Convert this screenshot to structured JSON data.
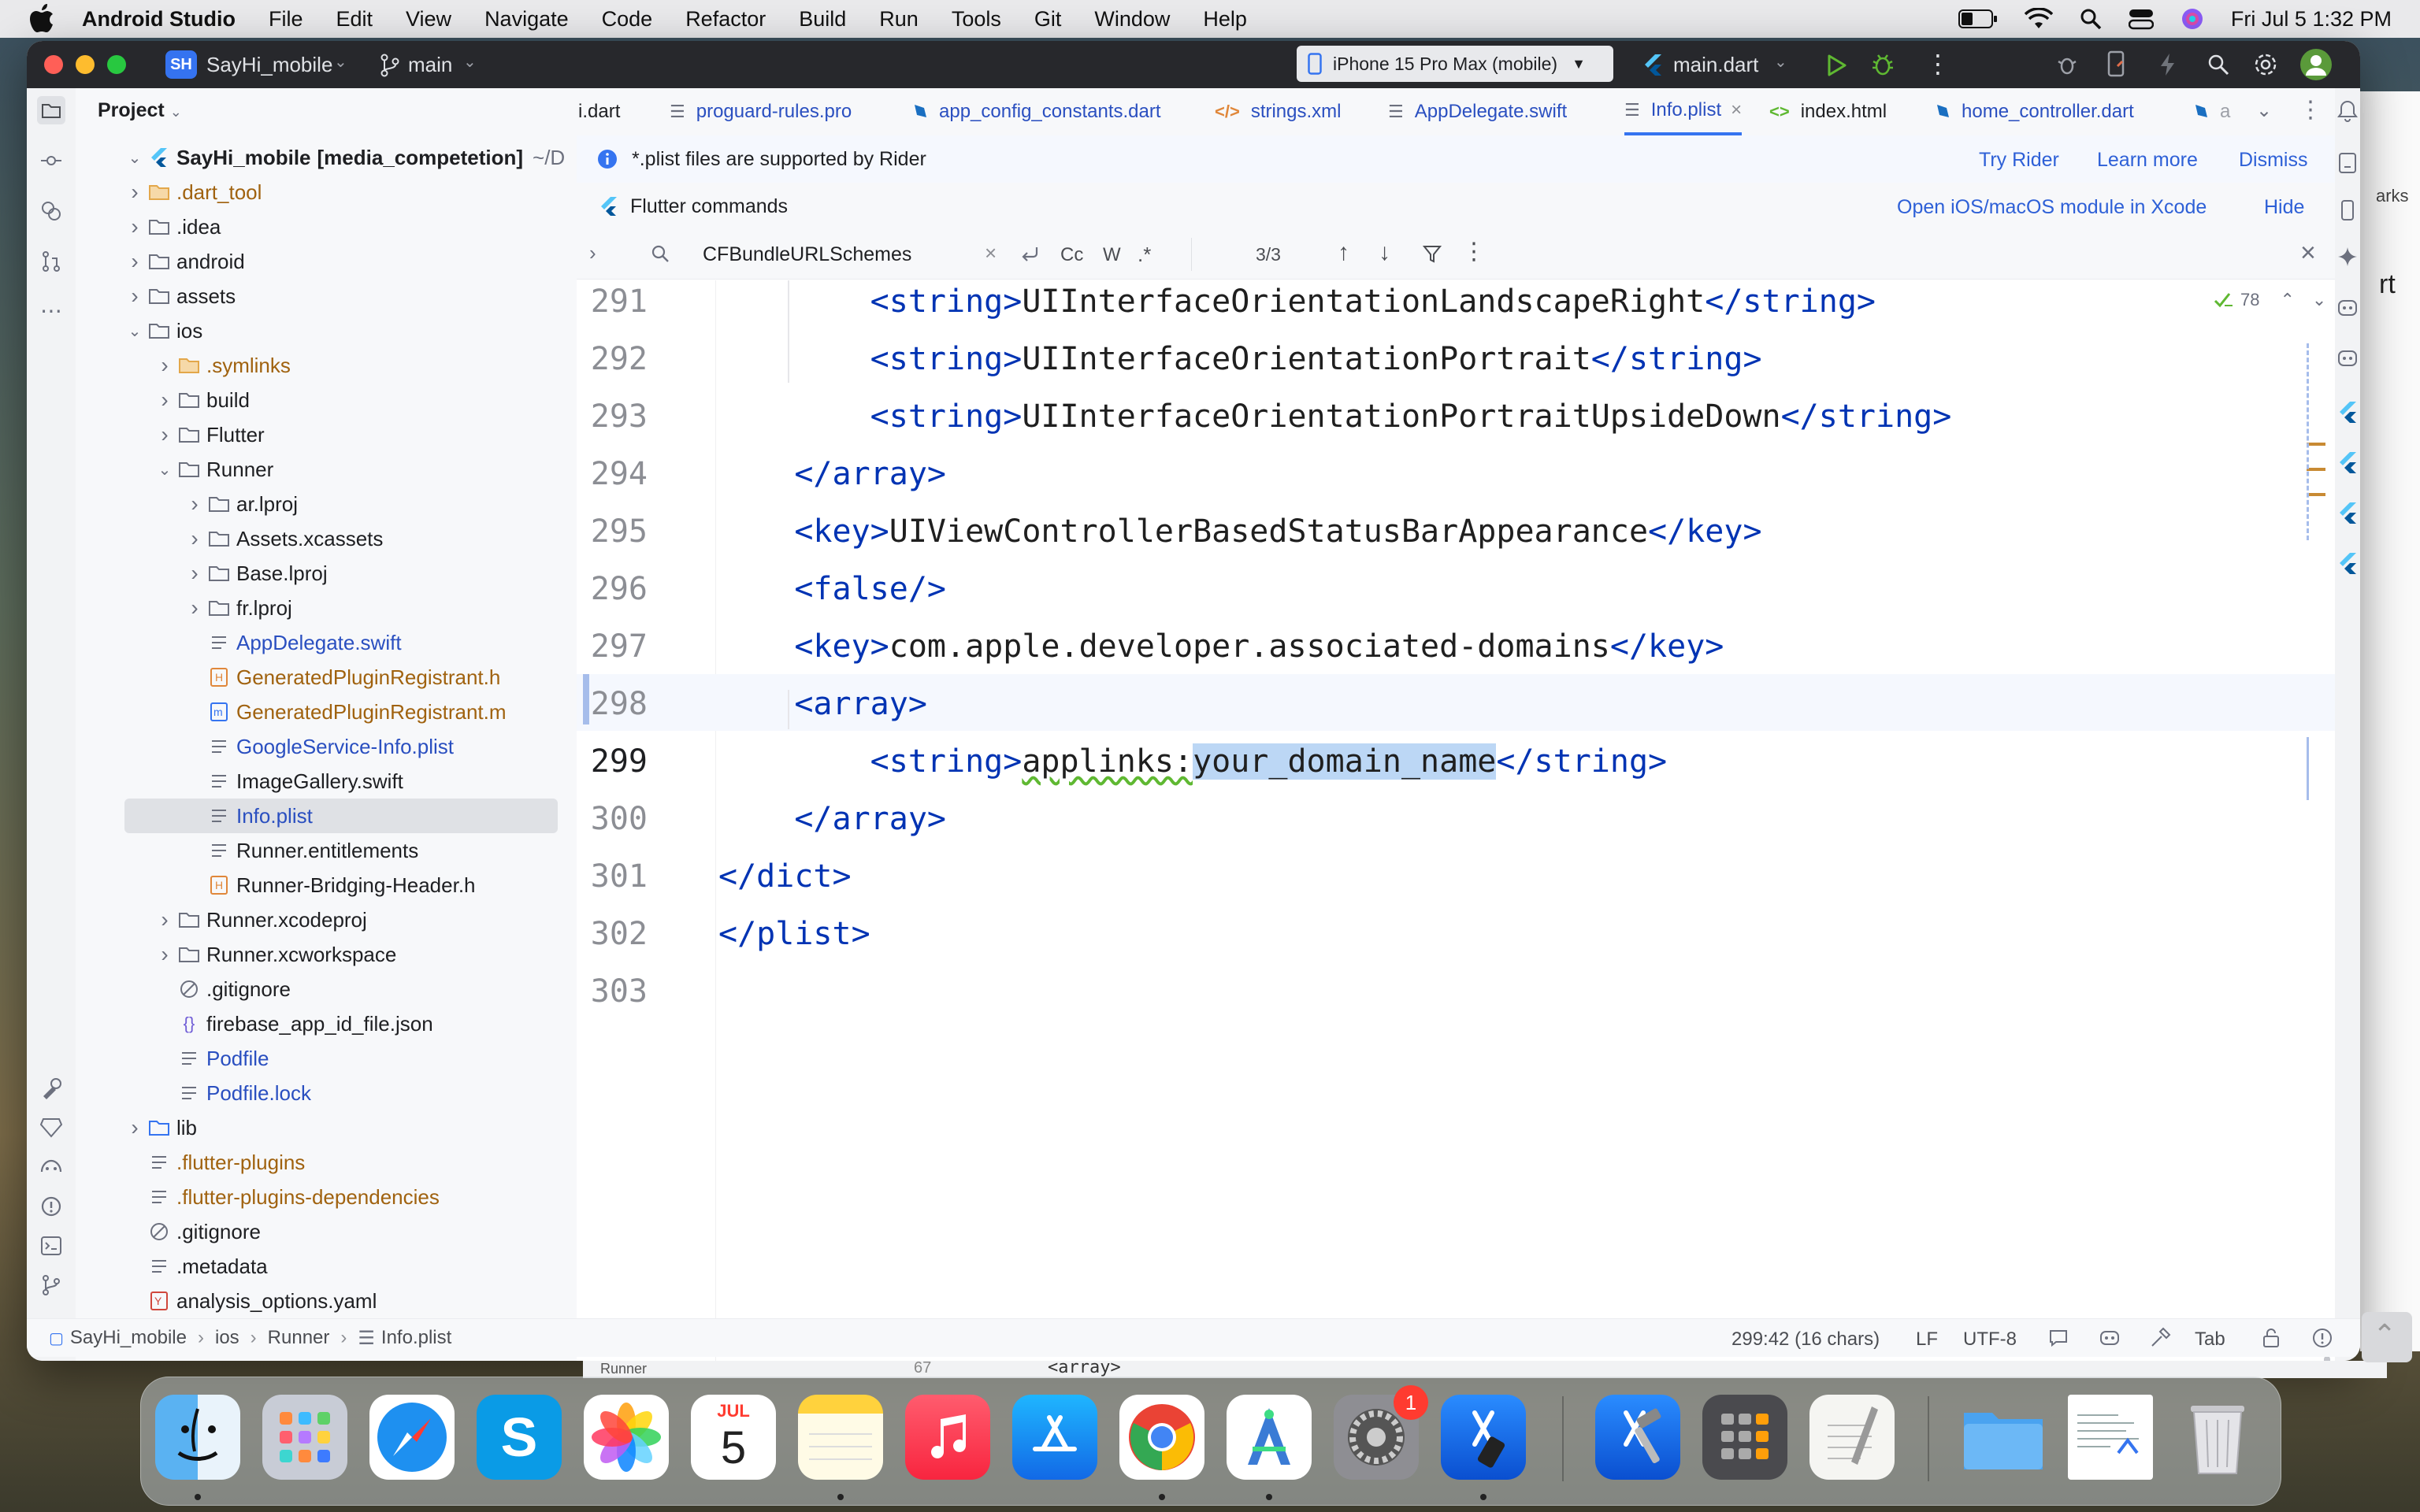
{
  "menubar": {
    "app_name": "Android Studio",
    "menus": [
      "File",
      "Edit",
      "View",
      "Navigate",
      "Code",
      "Refactor",
      "Build",
      "Run",
      "Tools",
      "Git",
      "Window",
      "Help"
    ],
    "datetime": "Fri Jul 5  1:32 PM"
  },
  "titlebar": {
    "project_badge": "SH",
    "project_name": "SayHi_mobile",
    "branch": "main",
    "device": "iPhone 15 Pro Max (mobile)",
    "run_config": "main.dart"
  },
  "project_panel": {
    "title": "Project",
    "root_name": "SayHi_mobile",
    "root_module": "[media_competetion]",
    "root_path": "~/D",
    "items": [
      {
        "label": ".dart_tool",
        "color": "#a0620f"
      },
      {
        "label": ".idea",
        "color": "#1e1f22"
      },
      {
        "label": "android",
        "color": "#1e1f22"
      },
      {
        "label": "assets",
        "color": "#1e1f22"
      },
      {
        "label": "ios",
        "color": "#1e1f22"
      },
      {
        "label": ".symlinks",
        "color": "#a0620f"
      },
      {
        "label": "build",
        "color": "#1e1f22"
      },
      {
        "label": "Flutter",
        "color": "#1e1f22"
      },
      {
        "label": "Runner",
        "color": "#1e1f22"
      },
      {
        "label": "ar.lproj",
        "color": "#1e1f22"
      },
      {
        "label": "Assets.xcassets",
        "color": "#1e1f22"
      },
      {
        "label": "Base.lproj",
        "color": "#1e1f22"
      },
      {
        "label": "fr.lproj",
        "color": "#1e1f22"
      },
      {
        "label": "AppDelegate.swift",
        "color": "#2a4fc0"
      },
      {
        "label": "GeneratedPluginRegistrant.h",
        "color": "#a0620f"
      },
      {
        "label": "GeneratedPluginRegistrant.m",
        "color": "#a0620f"
      },
      {
        "label": "GoogleService-Info.plist",
        "color": "#2a4fc0"
      },
      {
        "label": "ImageGallery.swift",
        "color": "#1e1f22"
      },
      {
        "label": "Info.plist",
        "color": "#2a4fc0"
      },
      {
        "label": "Runner.entitlements",
        "color": "#1e1f22"
      },
      {
        "label": "Runner-Bridging-Header.h",
        "color": "#1e1f22"
      },
      {
        "label": "Runner.xcodeproj",
        "color": "#1e1f22"
      },
      {
        "label": "Runner.xcworkspace",
        "color": "#1e1f22"
      },
      {
        "label": ".gitignore",
        "color": "#1e1f22"
      },
      {
        "label": "firebase_app_id_file.json",
        "color": "#1e1f22"
      },
      {
        "label": "Podfile",
        "color": "#2a4fc0"
      },
      {
        "label": "Podfile.lock",
        "color": "#2a4fc0"
      },
      {
        "label": "lib",
        "color": "#1e1f22"
      },
      {
        "label": ".flutter-plugins",
        "color": "#a0620f"
      },
      {
        "label": ".flutter-plugins-dependencies",
        "color": "#a0620f"
      },
      {
        "label": ".gitignore",
        "color": "#1e1f22"
      },
      {
        "label": ".metadata",
        "color": "#1e1f22"
      },
      {
        "label": "analysis_options.yaml",
        "color": "#1e1f22"
      }
    ]
  },
  "tabs": [
    {
      "label": "i.dart"
    },
    {
      "label": "proguard-rules.pro"
    },
    {
      "label": "app_config_constants.dart"
    },
    {
      "label": "strings.xml"
    },
    {
      "label": "AppDelegate.swift"
    },
    {
      "label": "Info.plist"
    },
    {
      "label": "index.html"
    },
    {
      "label": "home_controller.dart"
    },
    {
      "label": "a"
    }
  ],
  "rider_banner": {
    "text": "*.plist files are supported by Rider",
    "try": "Try Rider",
    "learn": "Learn more",
    "dismiss": "Dismiss"
  },
  "flutter_banner": {
    "text": "Flutter commands",
    "open_xcode": "Open iOS/macOS module in Xcode",
    "hide": "Hide"
  },
  "find": {
    "query": "CFBundleURLSchemes",
    "match_case": "Cc",
    "words": "W",
    "regex": ".*",
    "result": "3/3"
  },
  "editor": {
    "problems_count": "78",
    "lines": [
      {
        "num": "291",
        "indent": "        ",
        "open": "<string>",
        "text": "UIInterfaceOrientationLandscapeRight",
        "close": "</string>"
      },
      {
        "num": "292",
        "indent": "        ",
        "open": "<string>",
        "text": "UIInterfaceOrientationPortrait",
        "close": "</string>"
      },
      {
        "num": "293",
        "indent": "        ",
        "open": "<string>",
        "text": "UIInterfaceOrientationPortraitUpsideDown",
        "close": "</string>"
      },
      {
        "num": "294",
        "indent": "    ",
        "open": "</array>",
        "text": "",
        "close": ""
      },
      {
        "num": "295",
        "indent": "    ",
        "open": "<key>",
        "text": "UIViewControllerBasedStatusBarAppearance",
        "close": "</key>"
      },
      {
        "num": "296",
        "indent": "    ",
        "open": "<false/>",
        "text": "",
        "close": ""
      },
      {
        "num": "297",
        "indent": "    ",
        "open": "<key>",
        "text": "com.apple.developer.associated-domains",
        "close": "</key>"
      },
      {
        "num": "298",
        "indent": "    ",
        "open": "<array>",
        "text": "",
        "close": ""
      },
      {
        "num": "299",
        "indent": "        ",
        "open": "<string>",
        "text": "applinks:",
        "selected": "your_domain_name",
        "close": "</string>"
      },
      {
        "num": "300",
        "indent": "    ",
        "open": "</array>",
        "text": "",
        "close": ""
      },
      {
        "num": "301",
        "indent": "",
        "open": "</dict>",
        "text": "",
        "close": ""
      },
      {
        "num": "302",
        "indent": "",
        "open": "</plist>",
        "text": "",
        "close": ""
      },
      {
        "num": "303",
        "indent": "",
        "open": "",
        "text": "",
        "close": ""
      }
    ]
  },
  "statusbar": {
    "breadcrumb": [
      "SayHi_mobile",
      "ios",
      "Runner",
      "Info.plist"
    ],
    "position": "299:42 (16 chars)",
    "line_sep": "LF",
    "encoding": "UTF-8",
    "indent": "Tab"
  },
  "dock": {
    "calendar_month": "JUL",
    "calendar_day": "5",
    "settings_badge": "1"
  },
  "background_window": {
    "text_1": "arks",
    "text_2": "rt",
    "line_num": "67",
    "code": "<array>",
    "folder": "Runner"
  }
}
